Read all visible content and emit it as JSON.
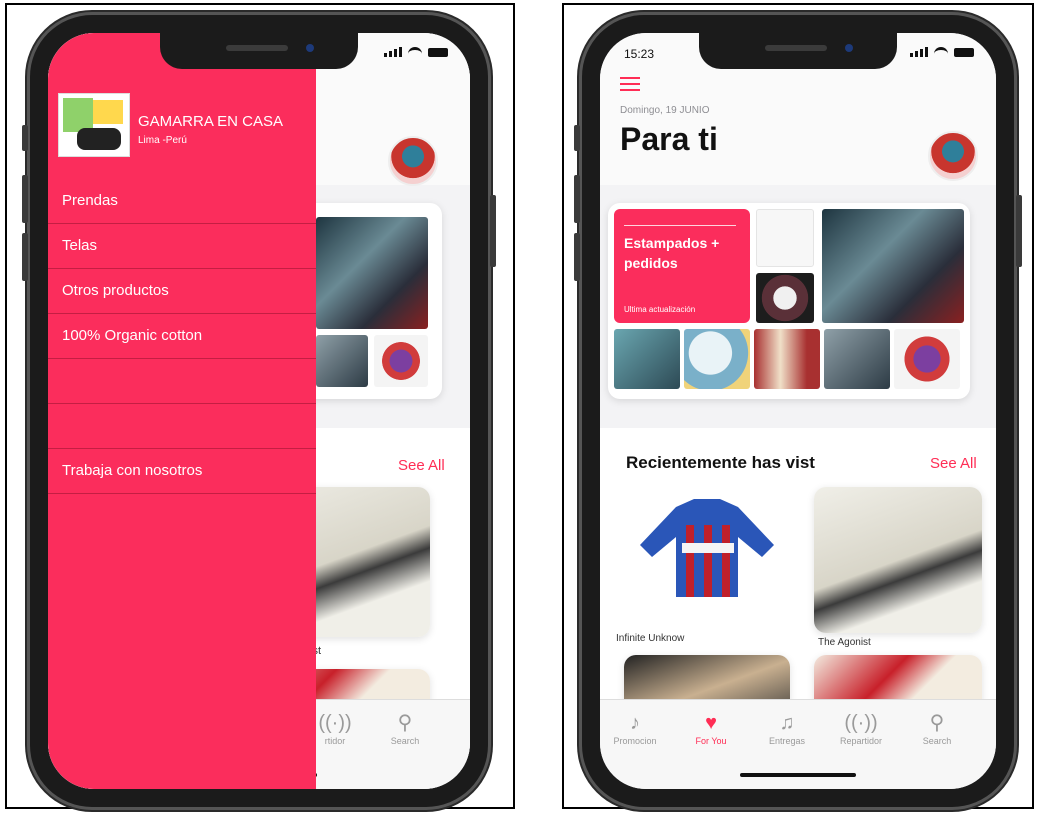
{
  "left_phone": {
    "drawer": {
      "brand_name": "GAMARRA EN CASA",
      "location": "Lima -Perú",
      "menu_items": [
        {
          "label": "Prendas"
        },
        {
          "label": "Telas"
        },
        {
          "label": "Otros productos"
        },
        {
          "label": "100% Organic cotton"
        },
        {
          "label": ""
        },
        {
          "label": ""
        },
        {
          "label": "Trabaja con nosotros"
        }
      ]
    },
    "background": {
      "see_all": "See All",
      "partial_caption": "ist",
      "tabs": [
        {
          "label": "rtidor",
          "icon": "broadcast-icon"
        },
        {
          "label": "Search",
          "icon": "search-icon"
        }
      ]
    }
  },
  "right_phone": {
    "status_time": "15:23",
    "date": "Domingo, 19 JUNIO",
    "title": "Para ti",
    "promo_card": {
      "title": "Estampados + pedidos",
      "subtitle": "Ultima actualización"
    },
    "recent_section": {
      "title": "Recientemente has vist",
      "see_all": "See All",
      "items": [
        {
          "caption": "Infinite Unknow"
        },
        {
          "caption": "The Agonist"
        }
      ]
    },
    "tabs": [
      {
        "label": "Promocion",
        "icon": "music-note-square-icon",
        "active": false
      },
      {
        "label": "For You",
        "icon": "heart-icon",
        "active": true
      },
      {
        "label": "Entregas",
        "icon": "music-notes-icon",
        "active": false
      },
      {
        "label": "Repartidor",
        "icon": "broadcast-icon",
        "active": false
      },
      {
        "label": "Search",
        "icon": "search-icon",
        "active": false
      }
    ]
  },
  "colors": {
    "accent": "#fb2d5c",
    "link": "#ff2d55",
    "inactive_tab": "#9a9a9a"
  }
}
